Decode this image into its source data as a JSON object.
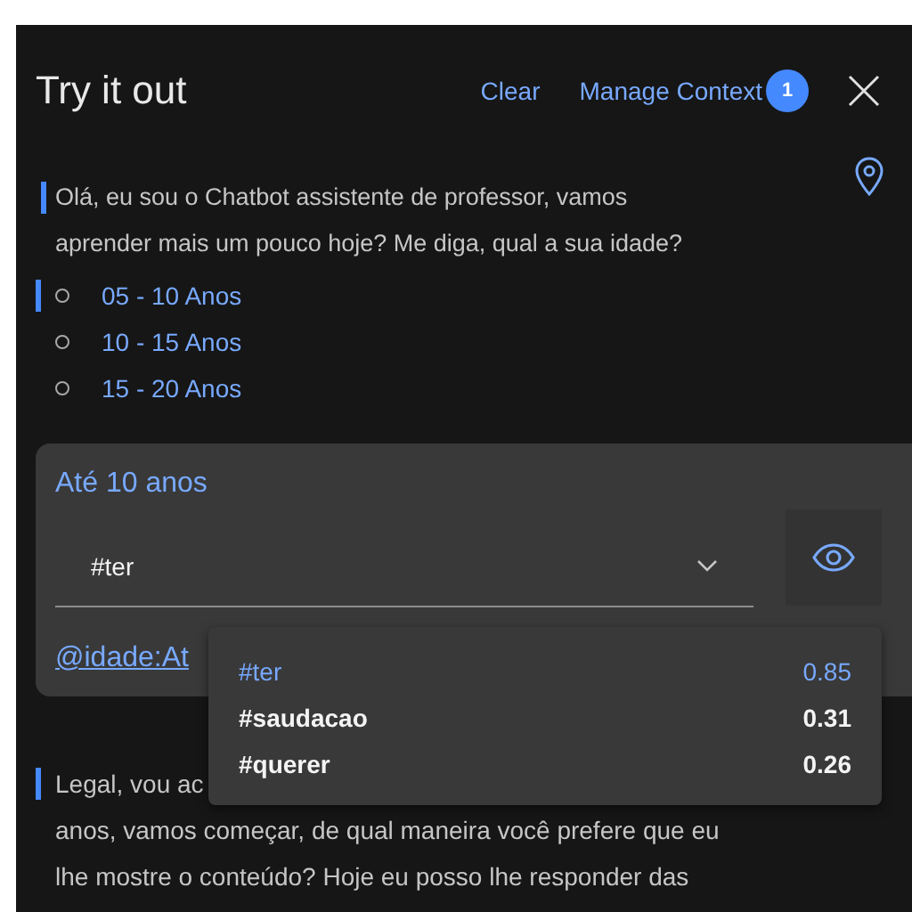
{
  "header": {
    "title": "Try it out",
    "clear": "Clear",
    "manage_context": "Manage Context",
    "context_count": "1"
  },
  "bot_message": {
    "text": "Olá, eu sou o Chatbot assistente de professor, vamos aprender mais um pouco hoje? Me diga, qual a sua idade?",
    "options": [
      {
        "label": "05 - 10 Anos",
        "selected": true
      },
      {
        "label": "10 - 15 Anos",
        "selected": false
      },
      {
        "label": "15 - 20 Anos",
        "selected": false
      }
    ]
  },
  "user_message": {
    "text": "Até 10 anos",
    "intent_value": "#ter",
    "entity_link": "@idade:At",
    "intents_open": true,
    "intents": [
      {
        "name": "#ter",
        "score": "0.85",
        "selected": true
      },
      {
        "name": "#saudacao",
        "score": "0.31",
        "selected": false
      },
      {
        "name": "#querer",
        "score": "0.26",
        "selected": false
      }
    ]
  },
  "bot_reply": {
    "lines": [
      "Legal, vou ac",
      "anos, vamos começar, de qual maneira você prefere que eu",
      "lhe mostre o conteúdo? Hoje eu posso lhe responder das"
    ]
  }
}
